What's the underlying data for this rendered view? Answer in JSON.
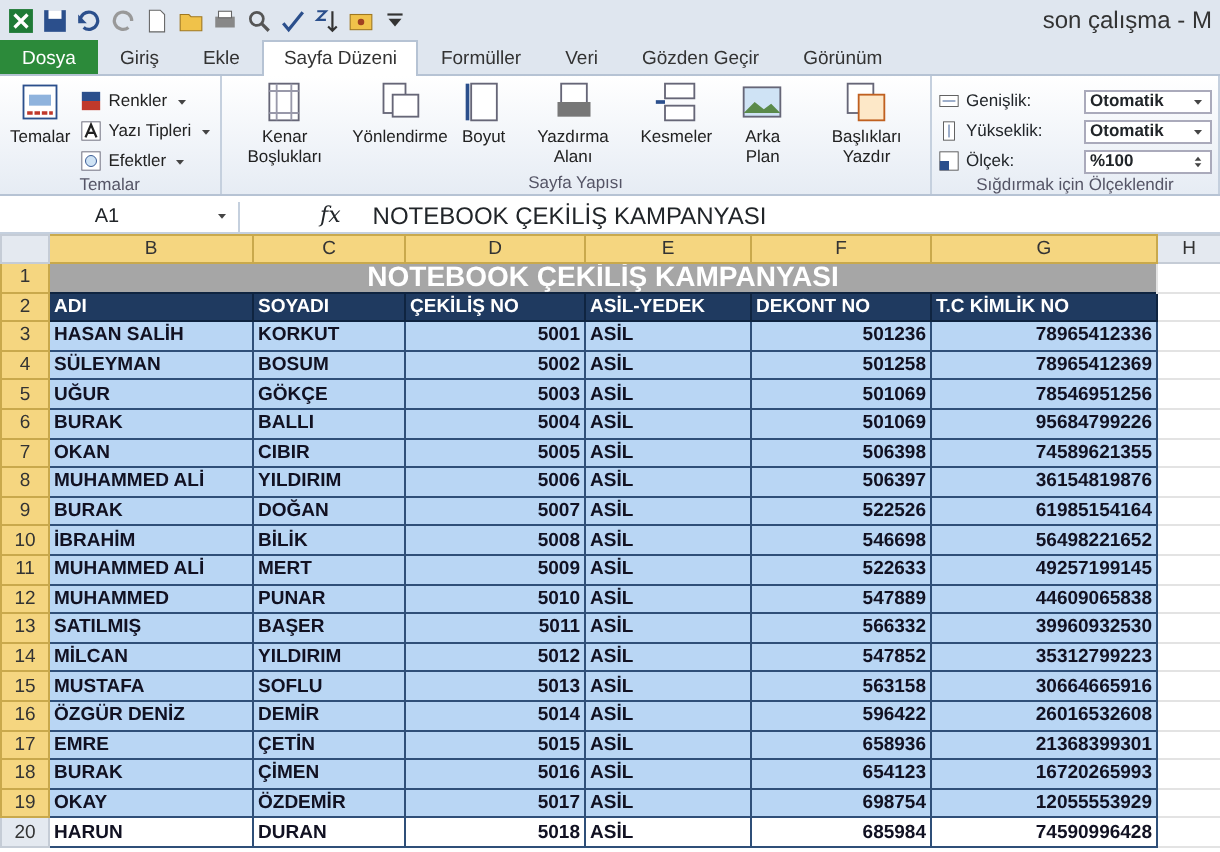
{
  "window": {
    "title": "son çalışma - M"
  },
  "tabs": [
    {
      "label": "Dosya",
      "kind": "file",
      "selected": false
    },
    {
      "label": "Giriş",
      "kind": "tab",
      "selected": false
    },
    {
      "label": "Ekle",
      "kind": "tab",
      "selected": false
    },
    {
      "label": "Sayfa Düzeni",
      "kind": "tab",
      "selected": true
    },
    {
      "label": "Formüller",
      "kind": "tab",
      "selected": false
    },
    {
      "label": "Veri",
      "kind": "tab",
      "selected": false
    },
    {
      "label": "Gözden Geçir",
      "kind": "tab",
      "selected": false
    },
    {
      "label": "Görünüm",
      "kind": "tab",
      "selected": false
    }
  ],
  "ribbon": {
    "groups": [
      {
        "label": "Temalar",
        "big_buttons": [
          {
            "label": "Temalar"
          }
        ],
        "small_buttons": [
          {
            "label": "Renkler"
          },
          {
            "label": "Yazı Tipleri"
          },
          {
            "label": "Efektler"
          }
        ]
      },
      {
        "label": "Sayfa Yapısı",
        "big_buttons": [
          {
            "label": "Kenar Boşlukları"
          },
          {
            "label": "Yönlendirme"
          },
          {
            "label": "Boyut"
          },
          {
            "label": "Yazdırma Alanı"
          },
          {
            "label": "Kesmeler"
          },
          {
            "label": "Arka Plan"
          },
          {
            "label": "Başlıkları Yazdır"
          }
        ]
      },
      {
        "label": "Sığdırmak için Ölçeklendir",
        "fields": [
          {
            "label": "Genişlik:",
            "value": "Otomatik",
            "kind": "dropdown"
          },
          {
            "label": "Yükseklik:",
            "value": "Otomatik",
            "kind": "dropdown"
          },
          {
            "label": "Ölçek:",
            "value": "%100",
            "kind": "spinner"
          }
        ]
      }
    ]
  },
  "formula_bar": {
    "name_box": "A1",
    "function_symbol": "fx",
    "value": "NOTEBOOK ÇEKİLİŞ KAMPANYASI"
  },
  "sheet": {
    "columns": [
      "B",
      "C",
      "D",
      "E",
      "F",
      "G",
      "H"
    ],
    "title_row_number": "1",
    "header_row_number": "2",
    "title": "NOTEBOOK ÇEKİLİŞ KAMPANYASI",
    "headers": [
      "ADI",
      "SOYADI",
      "ÇEKİLİŞ NO",
      "ASİL-YEDEK",
      "DEKONT NO",
      "T.C KİMLİK NO"
    ],
    "rows": [
      {
        "number": "3",
        "cells": [
          "HASAN SALİH",
          "KORKUT",
          "5001",
          "ASİL",
          "501236",
          "78965412336"
        ],
        "selected": true
      },
      {
        "number": "4",
        "cells": [
          "SÜLEYMAN",
          "BOSUM",
          "5002",
          "ASİL",
          "501258",
          "78965412369"
        ],
        "selected": true
      },
      {
        "number": "5",
        "cells": [
          "UĞUR",
          "GÖKÇE",
          "5003",
          "ASİL",
          "501069",
          "78546951256"
        ],
        "selected": true
      },
      {
        "number": "6",
        "cells": [
          "BURAK",
          "BALLI",
          "5004",
          "ASİL",
          "501069",
          "95684799226"
        ],
        "selected": true
      },
      {
        "number": "7",
        "cells": [
          "OKAN",
          "CIBIR",
          "5005",
          "ASİL",
          "506398",
          "74589621355"
        ],
        "selected": true
      },
      {
        "number": "8",
        "cells": [
          "MUHAMMED ALİ",
          "YILDIRIM",
          "5006",
          "ASİL",
          "506397",
          "36154819876"
        ],
        "selected": true
      },
      {
        "number": "9",
        "cells": [
          "BURAK",
          "DOĞAN",
          "5007",
          "ASİL",
          "522526",
          "61985154164"
        ],
        "selected": true
      },
      {
        "number": "10",
        "cells": [
          "İBRAHİM",
          "BİLİK",
          "5008",
          "ASİL",
          "546698",
          "56498221652"
        ],
        "selected": true
      },
      {
        "number": "11",
        "cells": [
          "MUHAMMED ALİ",
          "MERT",
          "5009",
          "ASİL",
          "522633",
          "49257199145"
        ],
        "selected": true
      },
      {
        "number": "12",
        "cells": [
          "MUHAMMED",
          "PUNAR",
          "5010",
          "ASİL",
          "547889",
          "44609065838"
        ],
        "selected": true
      },
      {
        "number": "13",
        "cells": [
          "SATILMIŞ",
          "BAŞER",
          "5011",
          "ASİL",
          "566332",
          "39960932530"
        ],
        "selected": true
      },
      {
        "number": "14",
        "cells": [
          "MİLCAN",
          "YILDIRIM",
          "5012",
          "ASİL",
          "547852",
          "35312799223"
        ],
        "selected": true
      },
      {
        "number": "15",
        "cells": [
          "MUSTAFA",
          "SOFLU",
          "5013",
          "ASİL",
          "563158",
          "30664665916"
        ],
        "selected": true
      },
      {
        "number": "16",
        "cells": [
          "ÖZGÜR DENİZ",
          "DEMİR",
          "5014",
          "ASİL",
          "596422",
          "26016532608"
        ],
        "selected": true
      },
      {
        "number": "17",
        "cells": [
          "EMRE",
          "ÇETİN",
          "5015",
          "ASİL",
          "658936",
          "21368399301"
        ],
        "selected": true
      },
      {
        "number": "18",
        "cells": [
          "BURAK",
          "ÇİMEN",
          "5016",
          "ASİL",
          "654123",
          "16720265993"
        ],
        "selected": true
      },
      {
        "number": "19",
        "cells": [
          "OKAY",
          "ÖZDEMİR",
          "5017",
          "ASİL",
          "698754",
          "12055553929"
        ],
        "selected": true
      },
      {
        "number": "20",
        "cells": [
          "HARUN",
          "DURAN",
          "5018",
          "ASİL",
          "685984",
          "74590996428"
        ],
        "selected": false
      }
    ]
  }
}
